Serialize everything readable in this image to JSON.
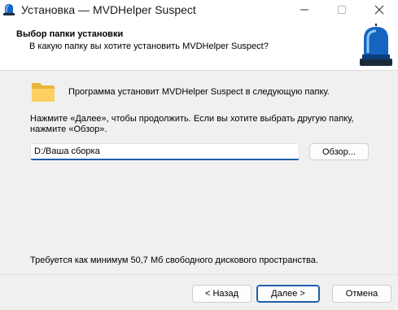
{
  "window": {
    "title": "Установка — MVDHelper Suspect",
    "controls": [
      "minimize-icon",
      "maximize-icon",
      "close-icon"
    ]
  },
  "header": {
    "title": "Выбор папки установки",
    "subtitle": "В какую папку вы хотите установить MVDHelper Suspect?",
    "logo_icon": "siren-icon"
  },
  "main": {
    "folder_icon": "folder-icon",
    "intro": "Программа установит MVDHelper Suspect в следующую папку.",
    "instruction": "Нажмите «Далее», чтобы продолжить. Если вы хотите выбрать другую папку, нажмите «Обзор».",
    "path_value": "D:/Ваша сборка",
    "browse_label": "Обзор...",
    "space_requirement": "Требуется как минимум 50,7 Мб свободного дискового пространства."
  },
  "footer": {
    "back_label": "< Назад",
    "next_label": "Далее >",
    "cancel_label": "Отмена"
  },
  "colors": {
    "accent": "#1f5fa8",
    "dialog_background": "#f0f0f0",
    "header_background": "#ffffff",
    "siren_blue": "#1565c0"
  }
}
